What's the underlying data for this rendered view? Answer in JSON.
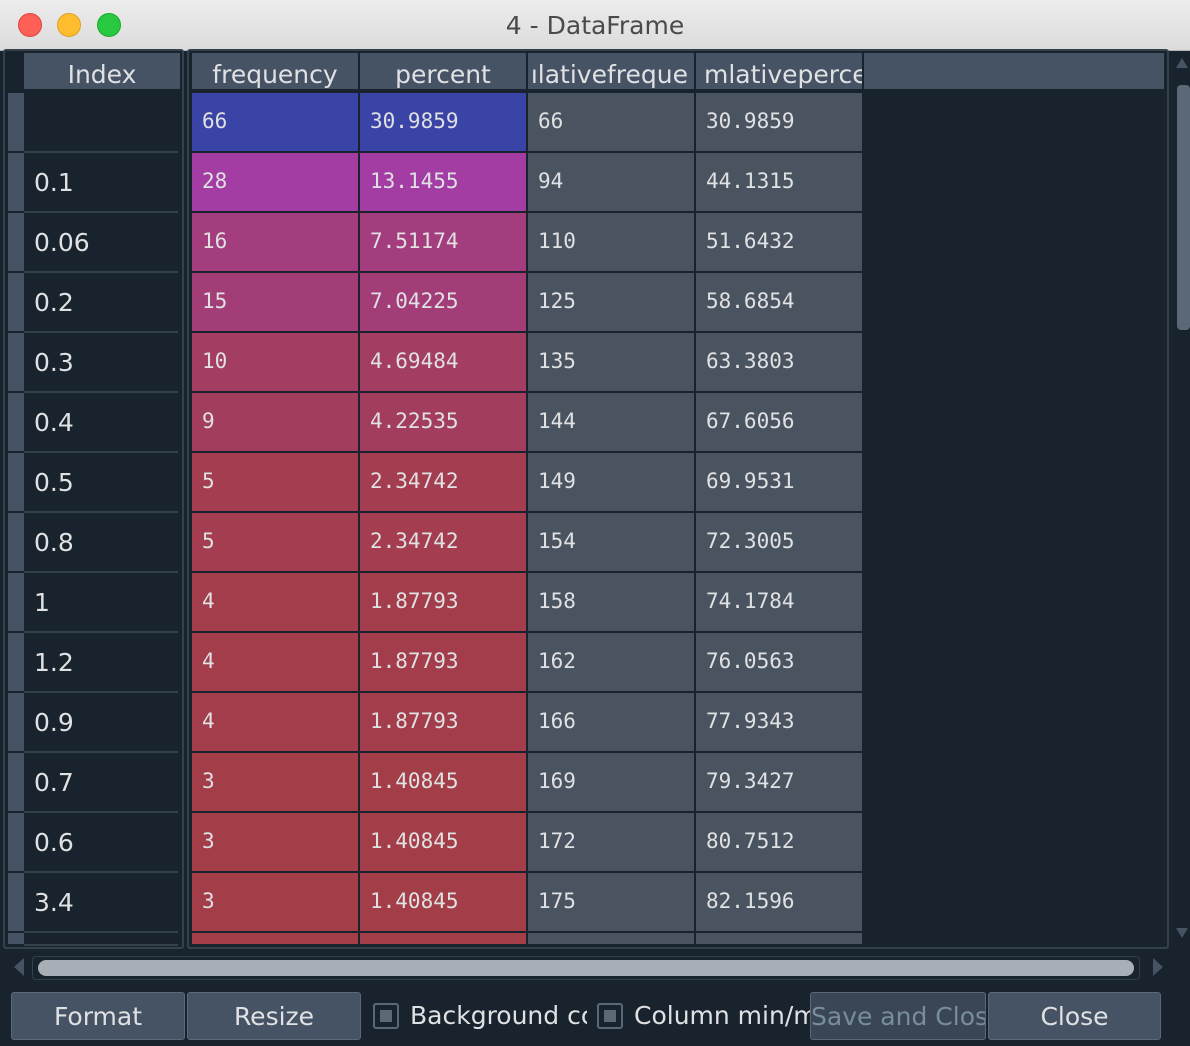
{
  "window": {
    "title": "4 - DataFrame"
  },
  "index_header": "Index",
  "columns": [
    "frequency",
    "percent",
    "ılativefreque",
    "mlativeperce"
  ],
  "rows": [
    {
      "index": "",
      "cells": [
        "66",
        "30.9859",
        "66",
        "30.9859"
      ],
      "color": "#3a43a6"
    },
    {
      "index": "0.1",
      "cells": [
        "28",
        "13.1455",
        "94",
        "44.1315"
      ],
      "color": "#a33da3"
    },
    {
      "index": "0.06",
      "cells": [
        "16",
        "7.51174",
        "110",
        "51.6432"
      ],
      "color": "#a33d7d"
    },
    {
      "index": "0.2",
      "cells": [
        "15",
        "7.04225",
        "125",
        "58.6854"
      ],
      "color": "#a33d78"
    },
    {
      "index": "0.3",
      "cells": [
        "10",
        "4.69484",
        "135",
        "63.3803"
      ],
      "color": "#a33d62"
    },
    {
      "index": "0.4",
      "cells": [
        "9",
        "4.22535",
        "144",
        "67.6056"
      ],
      "color": "#a33d5e"
    },
    {
      "index": "0.5",
      "cells": [
        "5",
        "2.34742",
        "149",
        "69.9531"
      ],
      "color": "#a33d4f"
    },
    {
      "index": "0.8",
      "cells": [
        "5",
        "2.34742",
        "154",
        "72.3005"
      ],
      "color": "#a33d4f"
    },
    {
      "index": "1",
      "cells": [
        "4",
        "1.87793",
        "158",
        "74.1784"
      ],
      "color": "#a33d4c"
    },
    {
      "index": "1.2",
      "cells": [
        "4",
        "1.87793",
        "162",
        "76.0563"
      ],
      "color": "#a33d4c"
    },
    {
      "index": "0.9",
      "cells": [
        "4",
        "1.87793",
        "166",
        "77.9343"
      ],
      "color": "#a33d4c"
    },
    {
      "index": "0.7",
      "cells": [
        "3",
        "1.40845",
        "169",
        "79.3427"
      ],
      "color": "#a33d48"
    },
    {
      "index": "0.6",
      "cells": [
        "3",
        "1.40845",
        "172",
        "80.7512"
      ],
      "color": "#a33d48"
    },
    {
      "index": "3.4",
      "cells": [
        "3",
        "1.40845",
        "175",
        "82.1596"
      ],
      "color": "#a33d48"
    },
    {
      "index": "",
      "cells": [
        "",
        "",
        "",
        ""
      ],
      "color": "#a33d48"
    }
  ],
  "buttons": {
    "format": "Format",
    "resize": "Resize",
    "background_checkbox": "Background cc",
    "column_minmax_checkbox": "Column min/m",
    "save_and_close": "Save and Clos",
    "close": "Close"
  }
}
